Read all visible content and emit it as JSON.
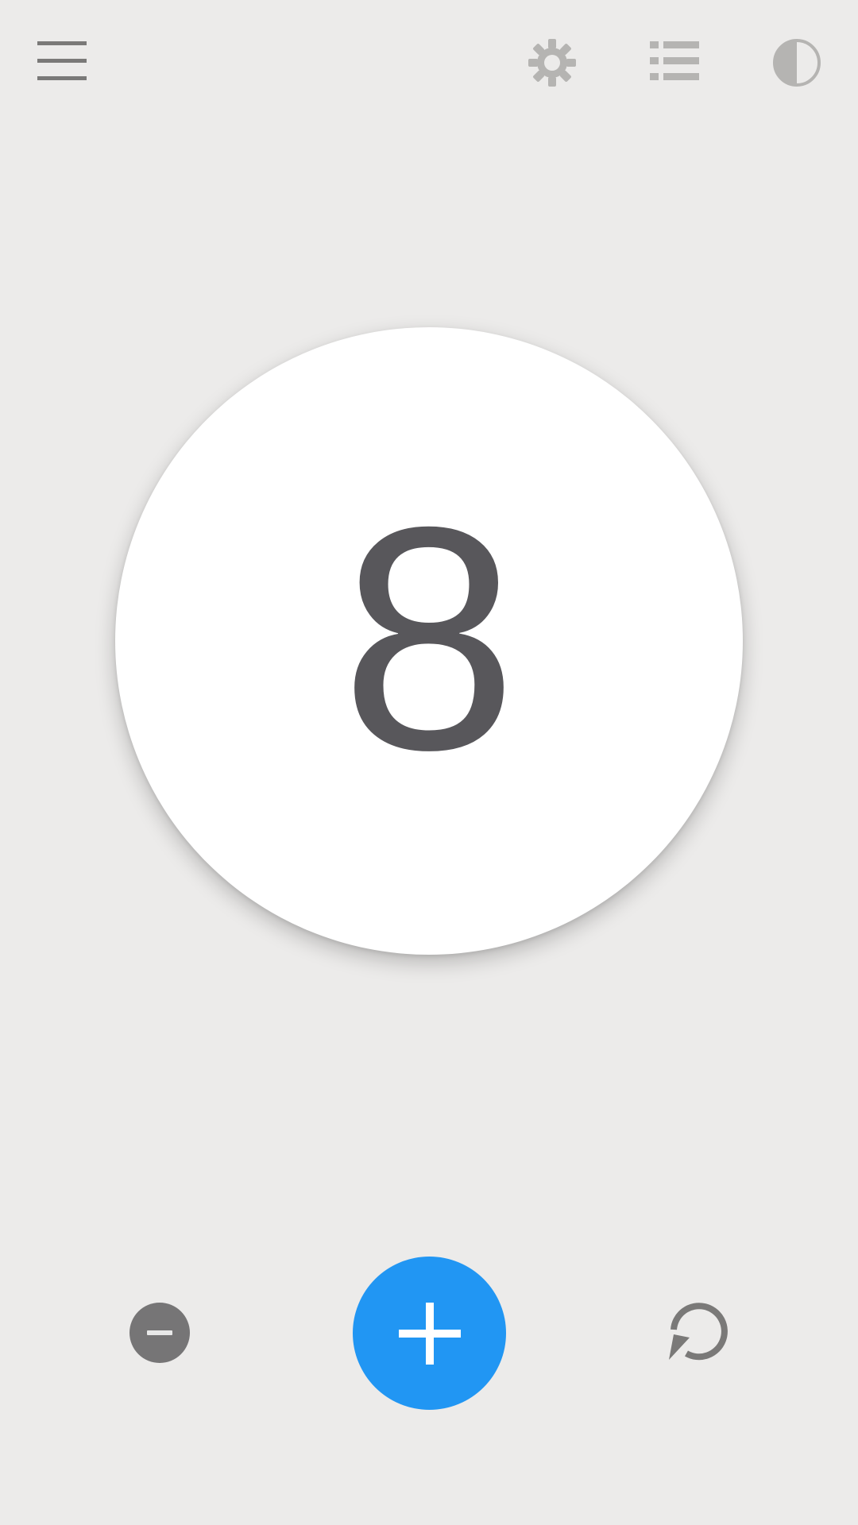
{
  "counter": {
    "value": "8"
  },
  "toolbar": {
    "icons": [
      "menu-icon",
      "gear-icon",
      "list-icon",
      "theme-contrast-icon"
    ]
  },
  "controls": {
    "icons": [
      "minus-icon",
      "plus-icon",
      "reset-icon"
    ]
  },
  "colors": {
    "background": "#ECEBEA",
    "counter_circle": "#FFFFFF",
    "counter_text": "#58575B",
    "accent": "#2196F3",
    "icon_dark": "#7A7978",
    "icon_light": "#B5B4B2"
  }
}
